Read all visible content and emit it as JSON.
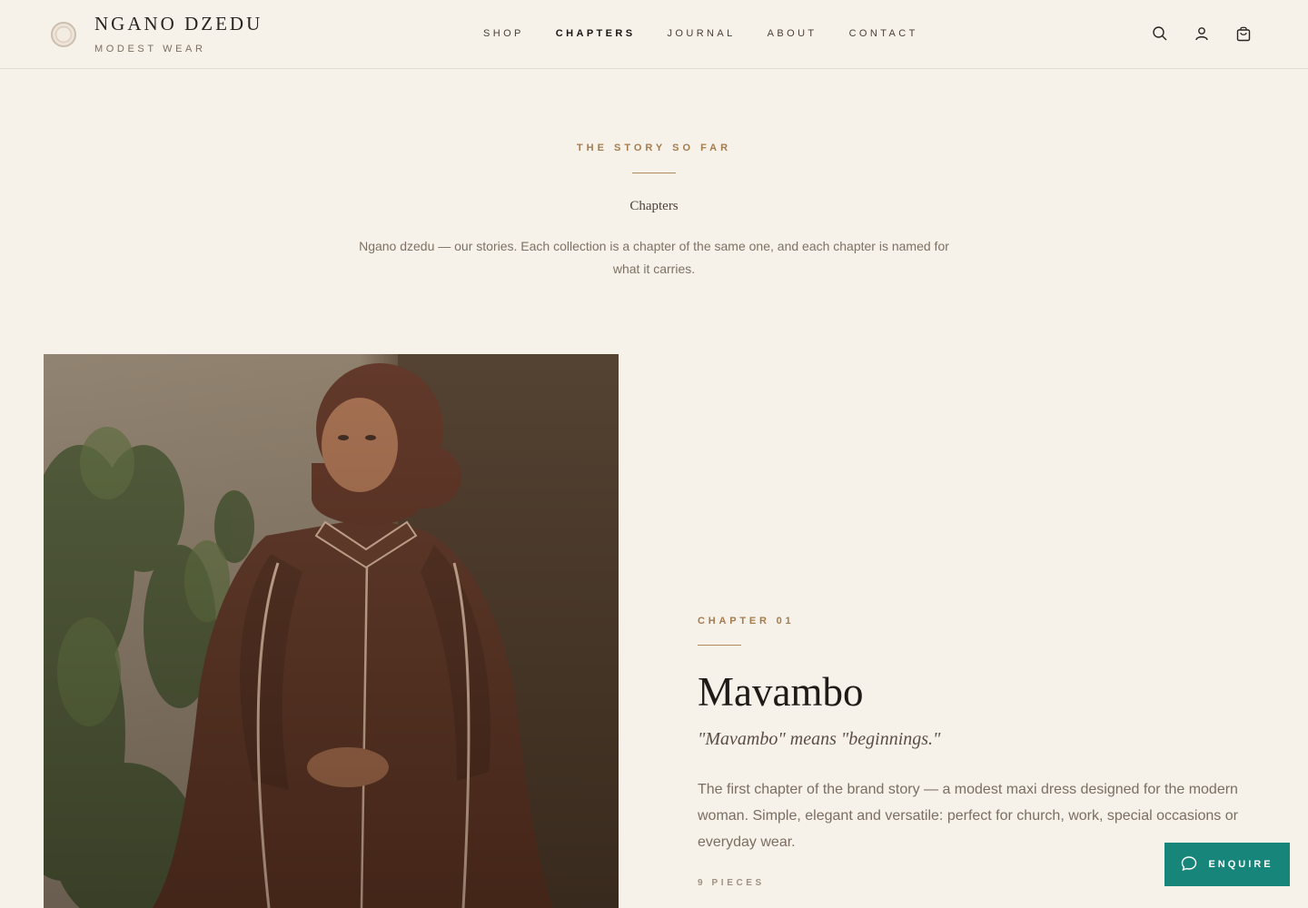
{
  "brand": {
    "name": "NGANO DZEDU",
    "tagline": "MODEST WEAR"
  },
  "nav": [
    {
      "label": "SHOP"
    },
    {
      "label": "CHAPTERS"
    },
    {
      "label": "JOURNAL"
    },
    {
      "label": "ABOUT"
    },
    {
      "label": "CONTACT"
    }
  ],
  "header_icons": [
    "search-icon",
    "account-icon",
    "cart-icon"
  ],
  "intro": {
    "eyebrow": "THE STORY SO FAR",
    "title": "Chapters",
    "text": "Ngano dzedu — our stories. Each collection is a chapter of the same one, and each chapter is named for what it carries."
  },
  "chapter": {
    "eyebrow": "CHAPTER 01",
    "title": "Mavambo",
    "subtitle": "\"Mavambo\" means \"beginnings.\"",
    "body": "The first chapter of the brand story — a modest maxi dress designed for the modern woman. Simple, elegant and versatile: perfect for church, work, special occasions or everyday wear.",
    "pieces": "9 PIECES"
  },
  "enquire": {
    "label": "ENQUIRE",
    "icon": "chat-bubble-icon"
  },
  "colors": {
    "background": "#f6f1e9",
    "accent": "#a47c4d",
    "button": "#17857a"
  }
}
